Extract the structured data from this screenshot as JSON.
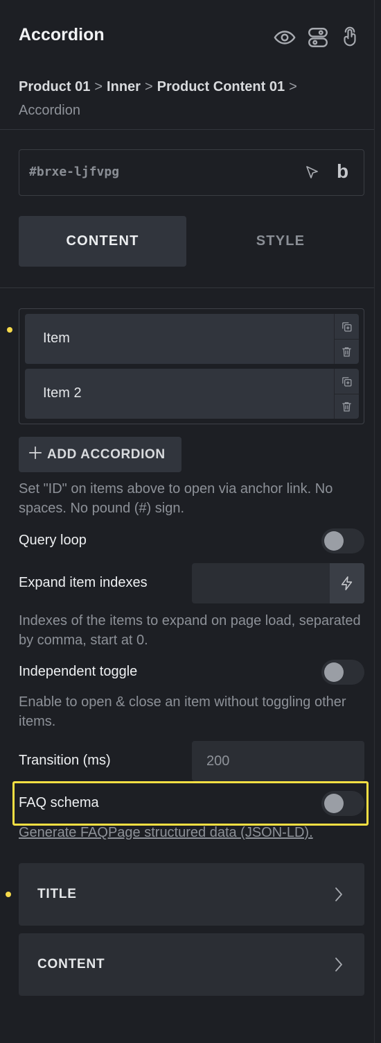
{
  "panel": {
    "title": "Accordion",
    "breadcrumb": [
      "Product 01",
      "Inner",
      "Product Content 01"
    ],
    "breadcrumb_sep": ">",
    "breadcrumb_current": "Accordion",
    "element_id": "#brxe-ljfvpg",
    "logo_letter": "b"
  },
  "tabs": {
    "content": "CONTENT",
    "style": "STYLE",
    "active": "content"
  },
  "repeater": {
    "items": [
      {
        "label": "Item"
      },
      {
        "label": "Item 2"
      }
    ],
    "add_label": "ADD ACCORDION"
  },
  "settings": {
    "anchor_help": "Set \"ID\" on items above to open via anchor link. No spaces. No pound (#) sign.",
    "query_loop": {
      "label": "Query loop",
      "enabled": false
    },
    "expand_indexes": {
      "label": "Expand item indexes",
      "value": "",
      "help": "Indexes of the items to expand on page load, separated by comma, start at 0."
    },
    "independent_toggle": {
      "label": "Independent toggle",
      "enabled": false,
      "help": "Enable to open & close an item without toggling other items."
    },
    "transition": {
      "label": "Transition (ms)",
      "value": "200"
    },
    "faq_schema": {
      "label": "FAQ schema",
      "enabled": false,
      "link": "Generate FAQPage structured data (JSON-LD)."
    }
  },
  "sections": [
    {
      "label": "TITLE"
    },
    {
      "label": "CONTENT"
    }
  ],
  "colors": {
    "accent": "#f7df43",
    "background": "#1d1f24",
    "surface": "#31353d"
  },
  "icons": [
    "eye-icon",
    "toggle-layout-icon",
    "pointer-hand-icon",
    "cursor-arrow-icon",
    "copy-icon",
    "trash-icon",
    "plus-icon",
    "bolt-icon",
    "chevron-right-icon"
  ]
}
